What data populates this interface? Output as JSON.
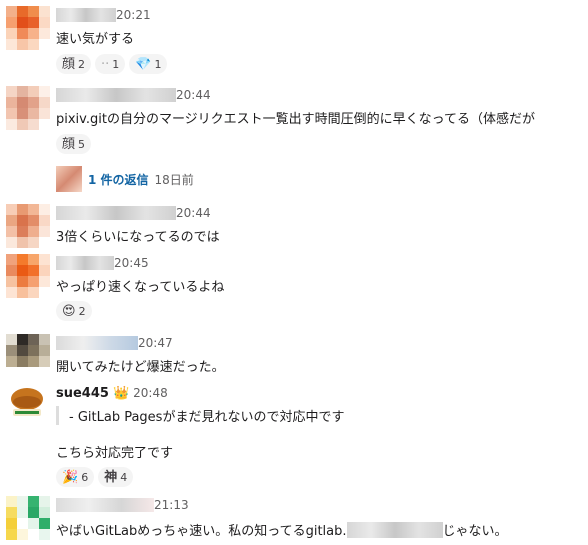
{
  "messages": [
    {
      "time": "20:21",
      "text": "速い気がする",
      "reactions": [
        {
          "emoji": "顔",
          "count": "2"
        },
        {
          "emoji": "··",
          "count": "1"
        },
        {
          "emoji": "💎",
          "count": "1"
        }
      ]
    },
    {
      "time": "20:44",
      "text": "pixiv.gitの自分のマージリクエスト一覧出す時間圧倒的に早くなってる（体感だが",
      "reactions": [
        {
          "emoji": "顔",
          "count": "5"
        }
      ],
      "thread": {
        "link": "1 件の返信",
        "ago": "18日前"
      }
    },
    {
      "time": "20:44",
      "text": "3倍くらいになってるのでは"
    },
    {
      "time": "20:45",
      "text": "やっぱり速くなっているよね",
      "reactions": [
        {
          "emoji": "😍",
          "count": "2"
        }
      ]
    },
    {
      "time": "20:47",
      "text": "開いてみたけど爆速だった。"
    },
    {
      "username": "sue445",
      "badge": "👑",
      "time": "20:48",
      "quote": "- GitLab Pagesがまだ見れないので対応中です",
      "text": "こちら対応完了です",
      "reactions": [
        {
          "emoji": "🎉",
          "count": "6"
        },
        {
          "emoji": "神",
          "count": "4"
        }
      ]
    },
    {
      "time": "21:13",
      "text_a": "やばいGitLabめっちゃ速い。私の知ってるgitlab.",
      "text_b": "じゃない。"
    }
  ]
}
